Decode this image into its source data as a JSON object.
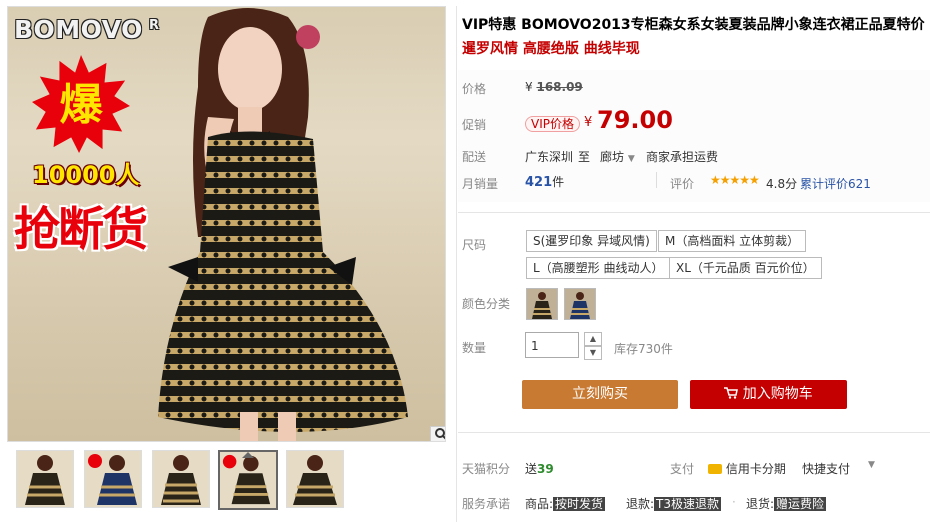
{
  "image": {
    "brand": "BOMOVO",
    "registered_mark": "R",
    "burst_text": "爆",
    "count_text": "10000人",
    "sold_text": "抢断货",
    "zoom_icon": "magnifier-icon",
    "thumbnail_count": 5,
    "selected_thumbnail": 4
  },
  "product": {
    "title": "VIP特惠 BOMOVO2013专柜森女系女装夏装品牌小象连衣裙正品夏特价",
    "subtitle": "暹罗风情 高腰绝版 曲线毕现"
  },
  "price": {
    "label": "价格",
    "currency": "¥",
    "original": "168.09"
  },
  "promo": {
    "label": "促销",
    "vip_tag": "VIP价格",
    "currency": "¥",
    "value": "79.00"
  },
  "shipping": {
    "label": "配送",
    "from": "广东深圳",
    "to_word": "至",
    "to": "廊坊",
    "fee": "商家承担运费"
  },
  "sales": {
    "label": "月销量",
    "count": "421",
    "unit": "件",
    "rating_label": "评价",
    "stars": "★★★★★",
    "score": "4.8分",
    "total_reviews": "累计评价621"
  },
  "size": {
    "label": "尺码",
    "options": [
      "S(暹罗印象 异域风情)",
      "M（高档面料 立体剪裁）",
      "L（高腰塑形 曲线动人）",
      "XL（千元品质 百元价位）"
    ]
  },
  "color": {
    "label": "颜色分类"
  },
  "quantity": {
    "label": "数量",
    "value": "1",
    "stock": "库存730件"
  },
  "actions": {
    "buy_now": "立刻购买",
    "add_to_cart": "加入购物车"
  },
  "points": {
    "label": "天猫积分",
    "prefix": "送",
    "value": "39"
  },
  "payment": {
    "label": "支付",
    "credit": "信用卡分期",
    "quick": "快捷支付"
  },
  "service": {
    "label": "服务承诺",
    "item1_prefix": "商品:",
    "item1_tag": "按时发货",
    "item2_prefix": "退款:",
    "item2_tag": "T3极速退款",
    "item3_prefix": "退货:",
    "item3_tag": "赠运费险"
  },
  "colors": {
    "accent_red": "#c40000",
    "buy_orange": "#c87932",
    "link_blue": "#2953a6"
  }
}
